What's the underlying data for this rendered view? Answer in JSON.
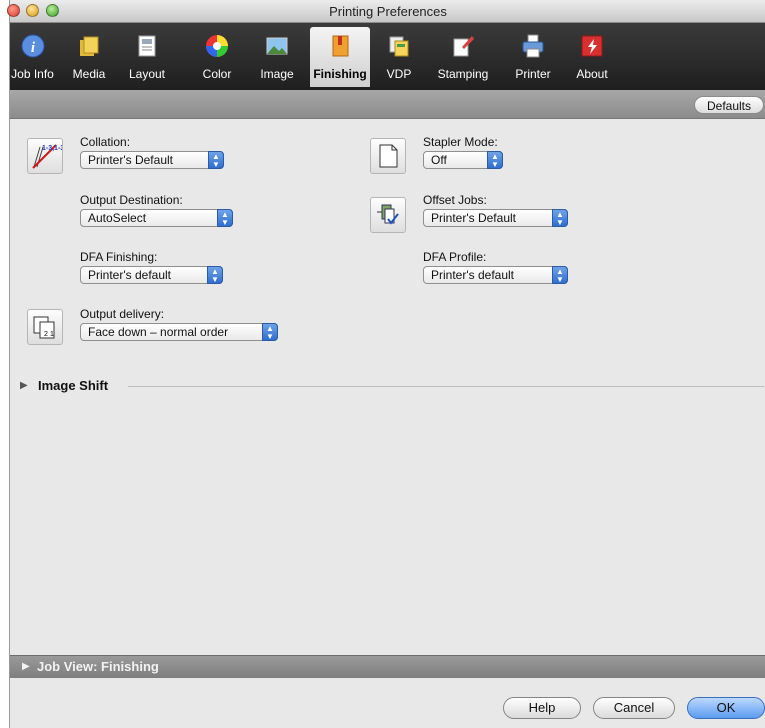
{
  "window": {
    "title": "Printing Preferences"
  },
  "tabs": [
    {
      "id": "job-info",
      "label": "Job Info",
      "icon": "info-icon"
    },
    {
      "id": "media",
      "label": "Media",
      "icon": "media-icon"
    },
    {
      "id": "layout",
      "label": "Layout",
      "icon": "layout-icon"
    },
    {
      "id": "color",
      "label": "Color",
      "icon": "color-wheel-icon"
    },
    {
      "id": "image",
      "label": "Image",
      "icon": "image-icon"
    },
    {
      "id": "finishing",
      "label": "Finishing",
      "icon": "finishing-icon",
      "active": true
    },
    {
      "id": "vdp",
      "label": "VDP",
      "icon": "vdp-icon"
    },
    {
      "id": "stamping",
      "label": "Stamping",
      "icon": "stamping-icon"
    },
    {
      "id": "printer",
      "label": "Printer",
      "icon": "printer-icon"
    },
    {
      "id": "about",
      "label": "About",
      "icon": "about-icon"
    }
  ],
  "toolbar": {
    "defaults_label": "Defaults"
  },
  "fields": {
    "collation": {
      "label": "Collation:",
      "value": "Printer's Default"
    },
    "output_destination": {
      "label": "Output Destination:",
      "value": "AutoSelect"
    },
    "dfa_finishing": {
      "label": "DFA Finishing:",
      "value": "Printer's default"
    },
    "output_delivery": {
      "label": "Output delivery:",
      "value": "Face down – normal order"
    },
    "stapler_mode": {
      "label": "Stapler Mode:",
      "value": "Off"
    },
    "offset_jobs": {
      "label": "Offset Jobs:",
      "value": "Printer's Default"
    },
    "dfa_profile": {
      "label": "DFA Profile:",
      "value": "Printer's default"
    }
  },
  "sections": {
    "image_shift": "Image Shift",
    "job_view": "Job View: Finishing"
  },
  "buttons": {
    "help": "Help",
    "cancel": "Cancel",
    "ok": "OK"
  },
  "colors": {
    "accent": "#2f6ed0",
    "toolbar_bg": "#2a2a2a"
  }
}
